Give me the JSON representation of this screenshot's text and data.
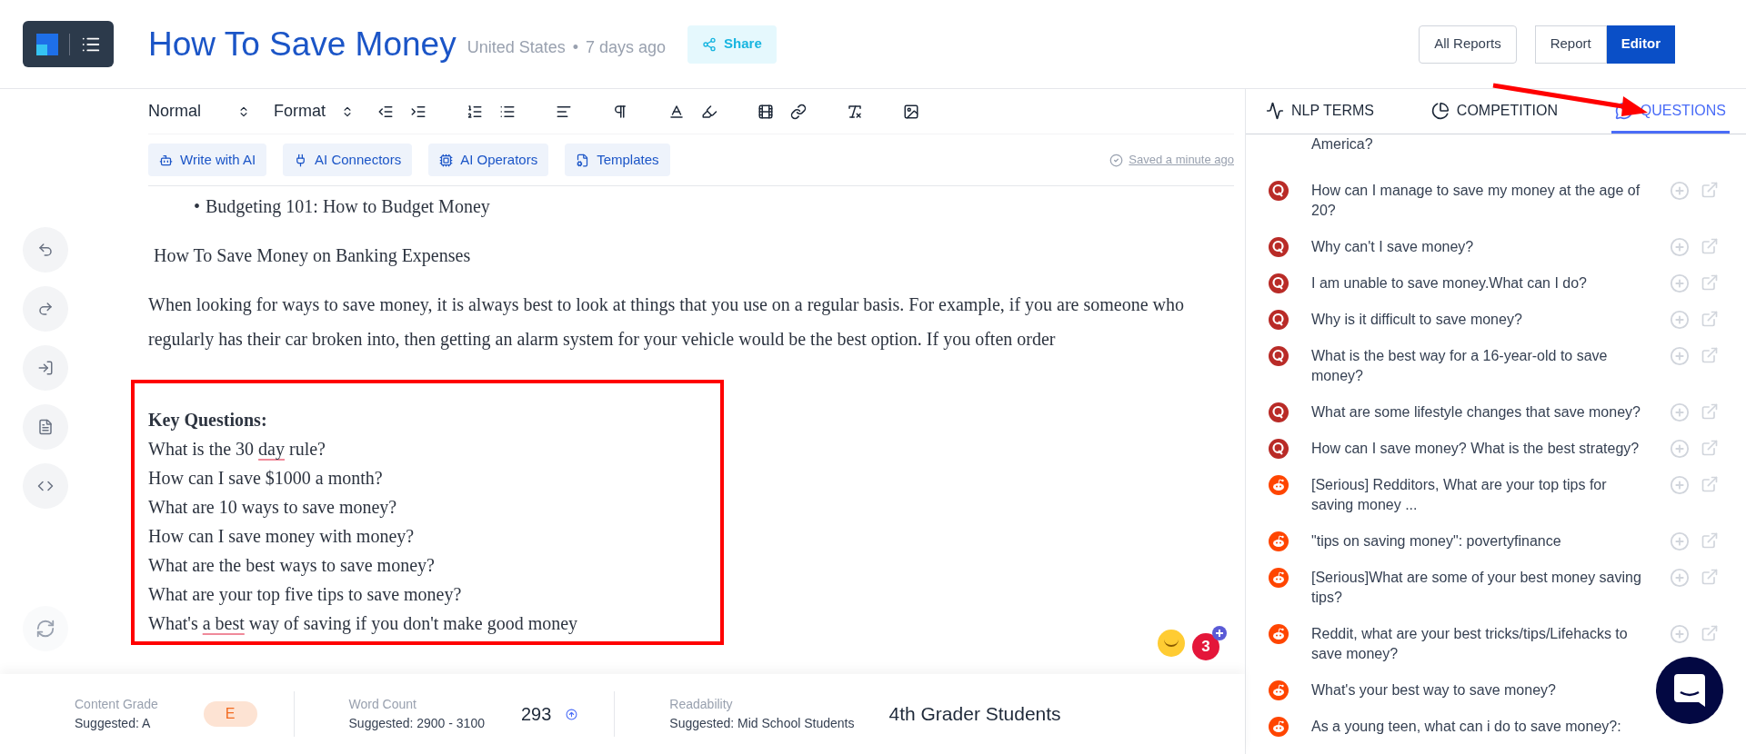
{
  "header": {
    "title": "How To Save Money",
    "country": "United States",
    "separator": "•",
    "age": "7 days ago",
    "share": "Share",
    "all_reports": "All Reports",
    "modes": [
      {
        "label": "Report",
        "selected": false
      },
      {
        "label": "Editor",
        "selected": true
      }
    ]
  },
  "toolbar": {
    "selects": [
      "Normal",
      "Format"
    ]
  },
  "ai_buttons": [
    {
      "label": "Write with AI",
      "kind": "bot"
    },
    {
      "label": "AI Connectors",
      "kind": "plug"
    },
    {
      "label": "AI Operators",
      "kind": "operator"
    },
    {
      "label": "Templates",
      "kind": "template"
    }
  ],
  "saved": "Saved a minute ago",
  "editor": {
    "bullet_mark": "•",
    "bullet": "Budgeting 101: How to Budget Money",
    "heading": "How To Save Money on Banking Expenses",
    "paragraph": "When looking for ways to save money, it is always best to look at things that you use on a regular basis. For example, if you are someone who regularly has their car broken into, then getting an alarm system for your vehicle would be the best option. If you often order",
    "key_title": "Key Questions:",
    "key_lines": [
      [
        {
          "text": "What is the 30 ",
          "misspelled": false
        },
        {
          "text": "day",
          "misspelled": true
        },
        {
          "text": " rule?",
          "misspelled": false
        }
      ],
      [
        {
          "text": "How can I save $1000 a month?",
          "misspelled": false
        }
      ],
      [
        {
          "text": "What are 10 ways to save money?",
          "misspelled": false
        }
      ],
      [
        {
          "text": "How can I save money with money?",
          "misspelled": false
        }
      ],
      [
        {
          "text": "What are the best ways to save money?",
          "misspelled": false
        }
      ],
      [
        {
          "text": "What are your top five tips to save money?",
          "misspelled": false
        }
      ],
      [
        {
          "text": "What's ",
          "misspelled": false
        },
        {
          "text": "a best",
          "misspelled": true
        },
        {
          "text": " way of saving if you don't make good money",
          "misspelled": false
        }
      ]
    ],
    "notification_count": "3"
  },
  "footer": [
    {
      "label": "Content Grade",
      "suggestion": "Suggested: A",
      "value": "E",
      "kind": "grade"
    },
    {
      "label": "Word Count",
      "suggestion": "Suggested: 2900 - 3100",
      "value": "293",
      "kind": "count"
    },
    {
      "label": "Readability",
      "suggestion": "Suggested: Mid School Students",
      "value": "4th Grader Students",
      "kind": "text"
    }
  ],
  "panel_tabs": [
    {
      "label": "NLP TERMS",
      "kind": "trend",
      "selected": false
    },
    {
      "label": "COMPETITION",
      "kind": "pie",
      "selected": false
    },
    {
      "label": "QUESTIONS",
      "kind": "questions",
      "selected": true
    }
  ],
  "partial_question": "America?",
  "questions": [
    {
      "text": "How can I manage to save my money at the age of 20?",
      "kind": "ring"
    },
    {
      "text": "Why can't I save money?",
      "kind": "ring"
    },
    {
      "text": "I am unable to save money.What can I do?",
      "kind": "ring"
    },
    {
      "text": "Why is it difficult to save money?",
      "kind": "ring"
    },
    {
      "text": "What is the best way for a 16-year-old to save money?",
      "kind": "ring"
    },
    {
      "text": "What are some lifestyle changes that save money?",
      "kind": "ring"
    },
    {
      "text": "How can I save money? What is the best strategy?",
      "kind": "ring"
    },
    {
      "text": "[Serious] Redditors, What are your top tips for saving money ...",
      "kind": "alien"
    },
    {
      "text": "\"tips on saving money\": povertyfinance",
      "kind": "alien"
    },
    {
      "text": "[Serious]What are some of your best money saving tips?",
      "kind": "alien"
    },
    {
      "text": "Reddit, what are your best tricks/tips/Lifehacks to save money?",
      "kind": "alien"
    },
    {
      "text": "What's your best way to save money?",
      "kind": "alien"
    },
    {
      "text": "As a young teen, what can i do to save money?:",
      "kind": "alien"
    }
  ]
}
